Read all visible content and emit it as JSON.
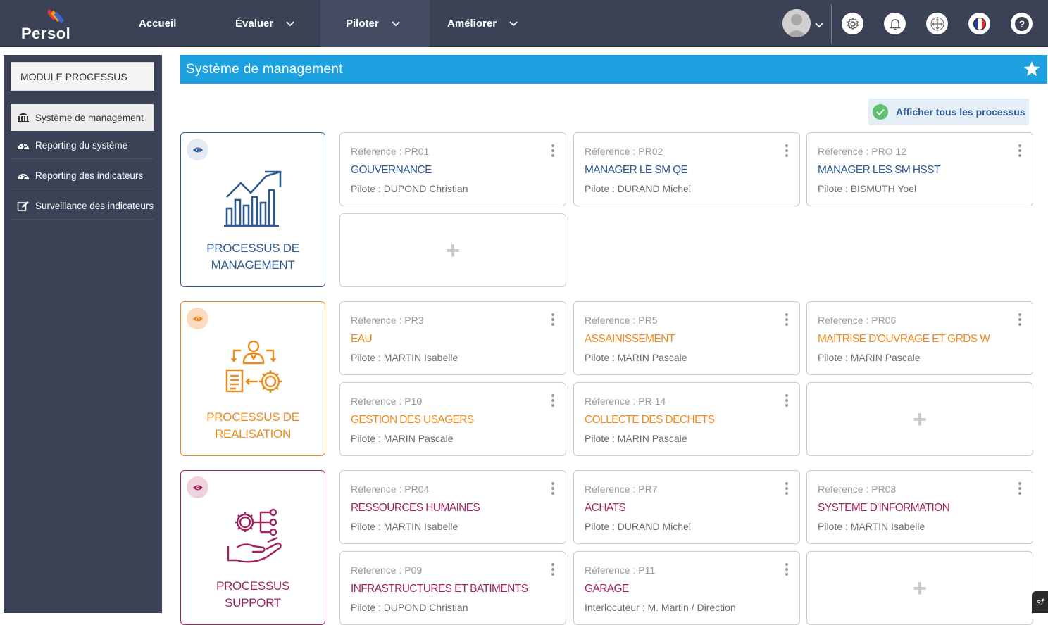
{
  "app": {
    "name": "Persol"
  },
  "nav": {
    "items": [
      {
        "label": "Accueil",
        "has_dropdown": false
      },
      {
        "label": "Évaluer",
        "has_dropdown": true
      },
      {
        "label": "Piloter",
        "has_dropdown": true,
        "active": true
      },
      {
        "label": "Améliorer",
        "has_dropdown": true
      }
    ],
    "icons": [
      "settings-icon",
      "bell-icon",
      "move-icon",
      "france-flag-icon",
      "help-icon"
    ]
  },
  "sidebar": {
    "module_title": "MODULE PROCESSUS",
    "items": [
      {
        "label": "Système de management",
        "icon": "bank-icon",
        "active": true
      },
      {
        "label": "Reporting du système",
        "icon": "dashboard-icon"
      },
      {
        "label": "Reporting des indicateurs",
        "icon": "dashboard-icon"
      },
      {
        "label": "Surveillance des indicateurs",
        "icon": "edit-icon"
      }
    ]
  },
  "page": {
    "title": "Système de management",
    "show_all_label": "Afficher tous les processus"
  },
  "groups": [
    {
      "title_line1": "PROCESSUS DE",
      "title_line2": "MANAGEMENT",
      "color": "#2f5b92",
      "cards": [
        {
          "ref": "Réference : PR01",
          "name": "GOUVERNANCE",
          "pilot": "Pilote : DUPOND Christian"
        },
        {
          "ref": "Réference : PR02",
          "name": "MANAGER LE SM QE",
          "pilot": "Pilote : DURAND Michel"
        },
        {
          "ref": "Réference : PRO 12",
          "name": "MANAGER LES SM HSST",
          "pilot": "Pilote : BISMUTH Yoel"
        }
      ]
    },
    {
      "title_line1": "PROCESSUS DE",
      "title_line2": "REALISATION",
      "color": "#ee8b1e",
      "cards": [
        {
          "ref": "Réference : PR3",
          "name": "EAU",
          "pilot": "Pilote : MARTIN Isabelle"
        },
        {
          "ref": "Réference : PR5",
          "name": "ASSAINISSEMENT",
          "pilot": "Pilote : MARIN Pascale"
        },
        {
          "ref": "Réference : PR06",
          "name": "MAITRISE D'OUVRAGE ET GRDS W",
          "pilot": "Pilote : MARIN Pascale"
        },
        {
          "ref": "Réference : P10",
          "name": "GESTION DES USAGERS",
          "pilot": "Pilote : MARIN Pascale"
        },
        {
          "ref": "Réference : PR 14",
          "name": "COLLECTE DES DECHETS",
          "pilot": "Pilote : MARIN Pascale"
        }
      ]
    },
    {
      "title_line1": "PROCESSUS",
      "title_line2": "SUPPORT",
      "color": "#a0255f",
      "cards": [
        {
          "ref": "Réference : PR04",
          "name": "RESSOURCES HUMAINES",
          "pilot": "Pilote : MARTIN Isabelle"
        },
        {
          "ref": "Réference : PR7",
          "name": "ACHATS",
          "pilot": "Pilote : DURAND Michel"
        },
        {
          "ref": "Réference : PR08",
          "name": "SYSTEME D'INFORMATION",
          "pilot": "Pilote : MARTIN Isabelle"
        },
        {
          "ref": "Réference : P09",
          "name": "INFRASTRUCTURES ET BATIMENTS",
          "pilot": "Pilote : DUPOND Christian"
        },
        {
          "ref": "Réference : P11",
          "name": "GARAGE",
          "pilot": "Interlocuteur : M. Martin / Direction"
        }
      ]
    }
  ],
  "add_label": "+",
  "debug_badge": "sf"
}
